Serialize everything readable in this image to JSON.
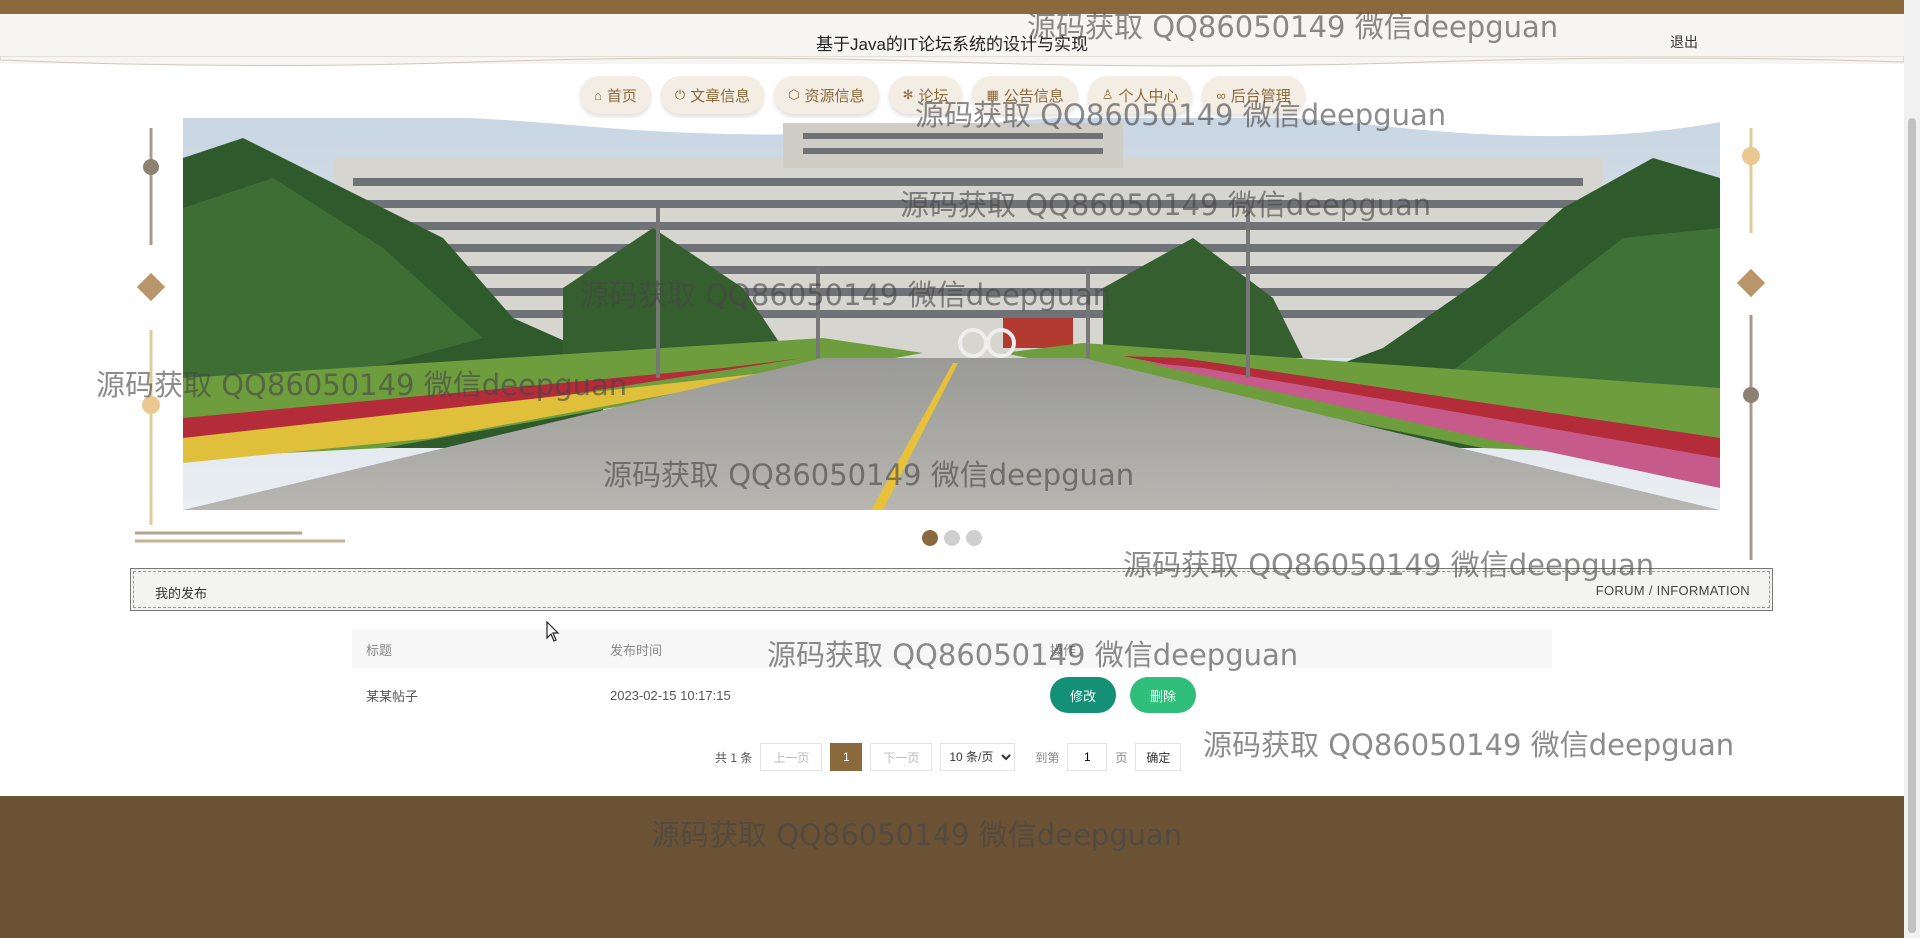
{
  "header": {
    "title": "基于Java的IT论坛系统的设计与实现",
    "logout_label": "退出"
  },
  "nav": {
    "items": [
      {
        "label": "首页",
        "icon": "home-icon"
      },
      {
        "label": "文章信息",
        "icon": "power-icon"
      },
      {
        "label": "资源信息",
        "icon": "cube-icon"
      },
      {
        "label": "论坛",
        "icon": "gear-icon"
      },
      {
        "label": "公告信息",
        "icon": "grid-icon"
      },
      {
        "label": "个人中心",
        "icon": "user-icon"
      },
      {
        "label": "后台管理",
        "icon": "link-icon"
      }
    ]
  },
  "carousel": {
    "slide_count": 3,
    "active_index": 0
  },
  "section": {
    "title": "我的发布",
    "subtitle": "FORUM / INFORMATION"
  },
  "table": {
    "headers": [
      "标题",
      "发布时间",
      "操作"
    ],
    "rows": [
      {
        "title": "某某帖子",
        "time": "2023-02-15 10:17:15",
        "edit_label": "修改",
        "delete_label": "删除"
      }
    ]
  },
  "pagination": {
    "total_label": "共 1 条",
    "prev_label": "上一页",
    "current_page": "1",
    "next_label": "下一页",
    "page_size_label": "10 条/页",
    "goto_label": "到第",
    "goto_value": "1",
    "page_unit": "页",
    "confirm_label": "确定"
  },
  "watermark": {
    "text": "源码获取 QQ86050149 微信deepguan"
  },
  "colors": {
    "brand": "#8a6a3c",
    "footer": "#6b5235",
    "edit": "#149077",
    "delete": "#2fbf7a"
  }
}
